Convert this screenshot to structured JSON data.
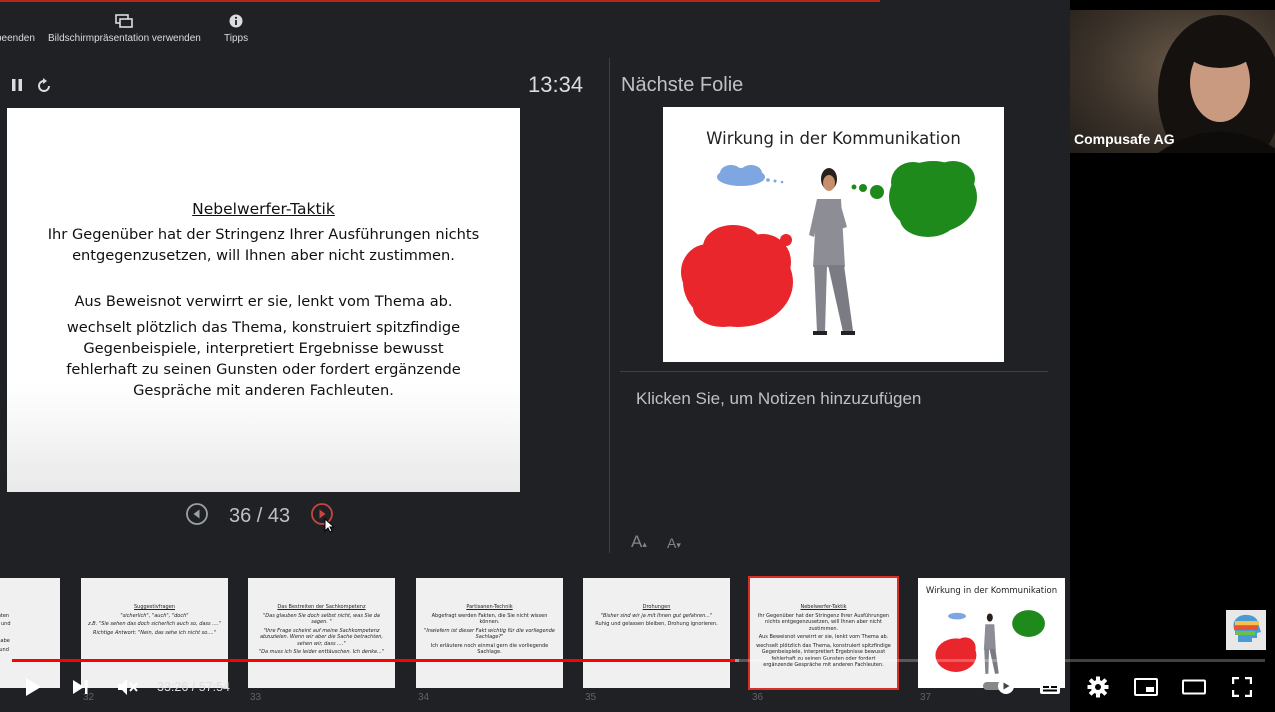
{
  "toolbar": {
    "end_label": "beenden",
    "presentation_label": "Bildschirmpräsentation verwenden",
    "tips_label": "Tipps"
  },
  "timer": "13:34",
  "current_slide": {
    "title": "Nebelwerfer-Taktik",
    "para1": "Ihr Gegenüber hat der Stringenz Ihrer Ausführungen nichts entgegenzusetzen, will Ihnen aber nicht zustimmen.",
    "para2": "Aus  Beweisnot verwirrt er sie, lenkt vom Thema ab.",
    "para3": "wechselt plötzlich das Thema, konstruiert spitzfindige Gegenbeispiele, interpretiert Ergebnisse bewusst fehlerhaft zu seinen Gunsten oder fordert ergänzende Gespräche mit anderen Fachleuten."
  },
  "slide_counter": "36 / 43",
  "next_slide": {
    "heading": "Nächste Folie",
    "title": "Wirkung in der Kommunikation"
  },
  "notes_placeholder": "Klicken Sie, um Notizen hinzuzufügen",
  "font_buttons": {
    "increase": "A",
    "decrease": "A"
  },
  "filmstrip": [
    {
      "number": "",
      "title": "agen",
      "lines": [
        "n Herde Elefanten",
        "Realitätsbezug und",
        "chkeit!",
        "t gestellt, ich habe",
        "chen Normen und",
        "n Ergebnis.",
        "Sie bis",
        "berechnen."
      ]
    },
    {
      "number": "32",
      "title": "Suggestivfragen",
      "lines": [
        "\"sicherlich\", \"auch\", \"doch\"",
        "z.B. \"Sie sehen das doch sicherlich auch so, dass ....\"",
        "Richtige Antwort: \"Nein, das sehe ich nicht so....\""
      ]
    },
    {
      "number": "33",
      "title": "Das Bestreiten der Sachkompetenz",
      "lines": [
        "\"Das glauben Sie doch selbst nicht, was Sie da sagen. \"",
        "\"Ihre Frage scheint auf meine Sachkompetenz abzuzielen. Wenn wir aber die Sache betrachten, sehen wir, dass ....\"",
        "\"Da muss ich Sie leider enttäuschen. Ich denke...\""
      ]
    },
    {
      "number": "34",
      "title": "Partisanen-Technik",
      "lines": [
        "Abgefragt werden Fakten, die Sie nicht wissen können.",
        "\"Inwiefern ist dieser Fakt wichtig für die vorliegende Sachlage?\"",
        "Ich erläutere noch einmal gern die vorliegende Sachlage."
      ]
    },
    {
      "number": "35",
      "title": "Drohungen",
      "lines": [
        "\"Bisher sind wir ja mit Ihnen gut gefahren...\"",
        "Ruhig und gelassen bleiben, Drohung ignorieren."
      ]
    },
    {
      "number": "36",
      "title": "Nebelwerfer-Taktik",
      "lines": [
        "Ihr Gegenüber hat der Stringenz Ihrer Ausführungen nichts entgegenzusetzen, will Ihnen aber nicht zustimmen.",
        "Aus  Beweisnot verwirrt er sie, lenkt vom Thema ab.",
        "wechselt plötzlich das Thema, konstruiert spitzfindige Gegenbeispiele, interpretiert Ergebnisse bewusst fehlerhaft zu seinen Gunsten oder fordert ergänzende Gespräche mit anderen Fachleuten."
      ]
    },
    {
      "number": "37",
      "title": "Wirkung in der Kommunikation",
      "lines": []
    }
  ],
  "webcam": {
    "name": "Compusafe AG"
  },
  "player": {
    "current_time": "33:26",
    "separator": " / ",
    "duration": "57:54",
    "progress": 0.5773,
    "buffered": 0.58
  },
  "colors": {
    "presenter_bg": "#202124",
    "progress_red": "#ff0000",
    "active_thumb_border": "#d93025",
    "bubble_red": "#e8262b",
    "bubble_green": "#1f8a1c",
    "bubble_blue": "#7ea6e0"
  }
}
